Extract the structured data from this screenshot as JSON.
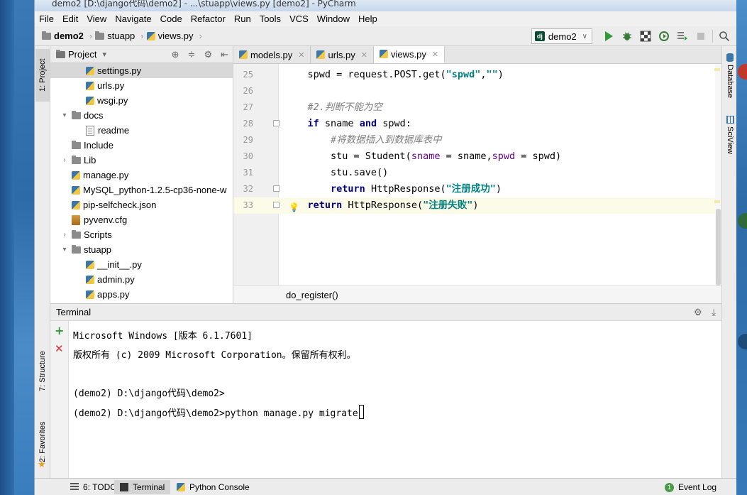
{
  "window": {
    "title": "demo2 [D:\\django代码\\demo2] - ...\\stuapp\\views.py [demo2] - PyCharm"
  },
  "menu": [
    "File",
    "Edit",
    "View",
    "Navigate",
    "Code",
    "Refactor",
    "Run",
    "Tools",
    "VCS",
    "Window",
    "Help"
  ],
  "nav": {
    "project": "demo2",
    "folder": "stuapp",
    "file": "views.py",
    "separator": "›"
  },
  "run_config": {
    "label": "demo2",
    "dropdown": "∨"
  },
  "left_tabs": {
    "project": "1: Project",
    "structure": "7: Structure",
    "favorites": "2: Favorites"
  },
  "right_tabs": {
    "database": "Database",
    "sciview": "SciView"
  },
  "project_panel": {
    "title": "Project",
    "dropdown": "▾",
    "tree": [
      {
        "label": "settings.py",
        "indent": 3,
        "icon": "python-file-icon",
        "arrow": "",
        "selected": true
      },
      {
        "label": "urls.py",
        "indent": 3,
        "icon": "python-file-icon",
        "arrow": ""
      },
      {
        "label": "wsgi.py",
        "indent": 3,
        "icon": "python-file-icon",
        "arrow": ""
      },
      {
        "label": "docs",
        "indent": 1,
        "icon": "folder-icon",
        "arrow": "▾"
      },
      {
        "label": "readme",
        "indent": 3,
        "icon": "text-file-icon",
        "arrow": ""
      },
      {
        "label": "Include",
        "indent": 1,
        "icon": "folder-icon",
        "arrow": ""
      },
      {
        "label": "Lib",
        "indent": 1,
        "icon": "folder-icon",
        "arrow": "›"
      },
      {
        "label": "manage.py",
        "indent": 2,
        "icon": "python-file-icon",
        "arrow": ""
      },
      {
        "label": "MySQL_python-1.2.5-cp36-none-w",
        "indent": 2,
        "icon": "python-file-icon",
        "arrow": ""
      },
      {
        "label": "pip-selfcheck.json",
        "indent": 2,
        "icon": "python-file-icon",
        "arrow": ""
      },
      {
        "label": "pyvenv.cfg",
        "indent": 2,
        "icon": "config-file-icon",
        "arrow": ""
      },
      {
        "label": "Scripts",
        "indent": 1,
        "icon": "folder-icon",
        "arrow": "›"
      },
      {
        "label": "stuapp",
        "indent": 1,
        "icon": "folder-icon",
        "arrow": "▾"
      },
      {
        "label": "__init__.py",
        "indent": 3,
        "icon": "python-file-icon",
        "arrow": ""
      },
      {
        "label": "admin.py",
        "indent": 3,
        "icon": "python-file-icon",
        "arrow": ""
      },
      {
        "label": "apps.py",
        "indent": 3,
        "icon": "python-file-icon",
        "arrow": ""
      }
    ]
  },
  "editor_tabs": [
    {
      "label": "models.py",
      "active": false
    },
    {
      "label": "urls.py",
      "active": false
    },
    {
      "label": "views.py",
      "active": true
    }
  ],
  "code": {
    "lines": [
      {
        "num": "25",
        "html": "    spwd = request.POST.get(<span class=\"str\">\"spwd\"</span>,<span class=\"str\">\"\"</span>)"
      },
      {
        "num": "26",
        "html": ""
      },
      {
        "num": "27",
        "html": "    <span class=\"cmt\">#2.判断不能为空</span>"
      },
      {
        "num": "28",
        "html": "    <span class=\"kw\">if</span> sname <span class=\"kw\">and</span> spwd:"
      },
      {
        "num": "29",
        "html": "        <span class=\"cmt\">#将数据插入到数据库表中</span>"
      },
      {
        "num": "30",
        "html": "        stu = Student(<span class=\"param\">sname</span> = sname,<span class=\"param\">spwd</span> = spwd)"
      },
      {
        "num": "31",
        "html": "        stu.save()"
      },
      {
        "num": "32",
        "html": "        <span class=\"kw\">return</span> HttpResponse(<span class=\"str\">\"注册成功\"</span>)"
      },
      {
        "num": "33",
        "html": "    <span class=\"kw\">return</span> HttpResponse(<span class=\"str\">\"注册失败\"</span>)"
      }
    ],
    "function_breadcrumb": "do_register()"
  },
  "terminal": {
    "title": "Terminal",
    "lines": [
      "Microsoft Windows [版本 6.1.7601]",
      "版权所有 (c) 2009 Microsoft Corporation。保留所有权利。",
      "",
      "(demo2) D:\\django代码\\demo2>",
      "(demo2) D:\\django代码\\demo2>python manage.py migrate"
    ]
  },
  "bottom_tabs": [
    {
      "label": "6: TODO",
      "active": false
    },
    {
      "label": "Terminal",
      "active": true
    },
    {
      "label": "Python Console",
      "active": false
    }
  ],
  "event_log": {
    "badge": "1",
    "label": "Event Log"
  },
  "colors": {
    "keyword": "#000080",
    "string": "#008080",
    "comment": "#808080",
    "run_green": "#2f9a3a",
    "current_line": "#fcfbe8"
  }
}
